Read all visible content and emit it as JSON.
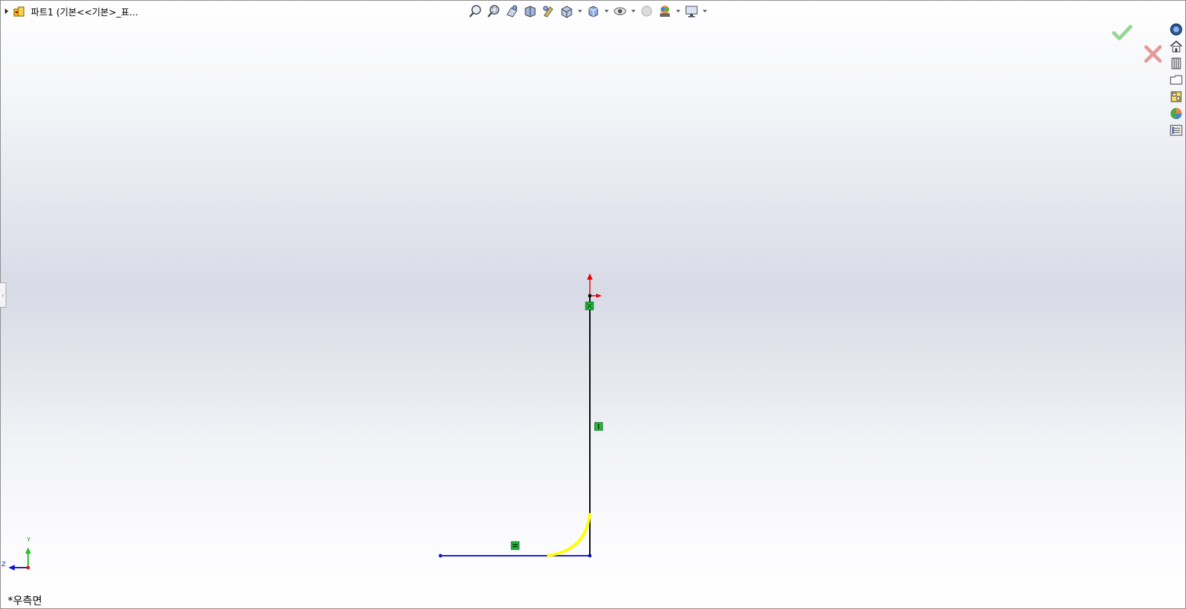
{
  "feature_tree": {
    "title": "파트1  (기본<<기본>_표..."
  },
  "view": {
    "name": "*우측면"
  },
  "triad": {
    "y_label": "Y",
    "z_label": "Z"
  },
  "heads_up_toolbar": {
    "icons": [
      "zoom-to-fit-icon",
      "zoom-to-area-icon",
      "previous-view-icon",
      "section-view-icon",
      "dynamic-annotation-icon",
      "view-orientation-icon",
      "display-style-icon",
      "hide-show-items-icon",
      "edit-appearance-icon",
      "apply-scene-icon",
      "view-settings-icon"
    ]
  },
  "task_pane": {
    "icons": [
      "solidworks-resources-icon",
      "home-icon",
      "design-library-icon",
      "file-explorer-icon",
      "view-palette-icon",
      "appearances-icon",
      "custom-properties-icon"
    ]
  },
  "colors": {
    "construction_line": "#0000ff",
    "selected_arc": "#ffff00",
    "sketch_line": "#000000",
    "relation_marker": "#1fbf3a",
    "ok": "#6fcf6f",
    "cancel": "#e07070"
  }
}
